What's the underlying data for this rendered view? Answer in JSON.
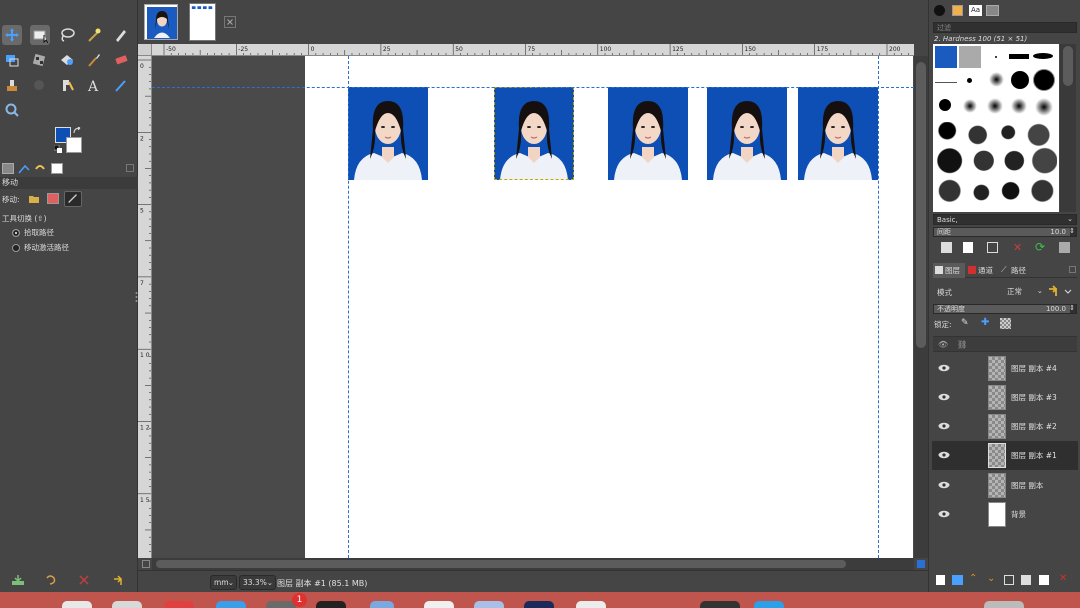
{
  "toolbox": {
    "tools": [
      "move",
      "rect-select",
      "free-select",
      "fuzzy-select",
      "paths",
      "align",
      "unified-transform",
      "warp-transform",
      "paintbrush",
      "eraser",
      "clone",
      "smudge",
      "color-picker",
      "text",
      "dodge-burn",
      "zoom"
    ],
    "fg_color": "#0d4fb4",
    "bg_color": "#ffffff"
  },
  "tool_options": {
    "title": "移动",
    "move_label": "移动:",
    "toggle_label": "工具切换 (⇧)",
    "radio1": "拾取路径",
    "radio2": "移动激活路径"
  },
  "canvas": {
    "ruler_top_labels": [
      "-50",
      "-25",
      "0",
      "25",
      "50",
      "75",
      "100",
      "125",
      "150",
      "175",
      "200"
    ],
    "ruler_left_labels": [
      "0",
      "2",
      "5",
      "7",
      "1 0",
      "1 2",
      "1 5"
    ]
  },
  "statusbar": {
    "unit": "mm",
    "zoom": "33.3%",
    "layer_info": "图层 副本 #1 (85.1 MB)"
  },
  "brushes": {
    "filter_placeholder": "过滤",
    "brush_name": "2. Hardness 100 (51 × 51)",
    "tag_preset": "Basic,",
    "spacing_label": "间距",
    "spacing_value": "10.0"
  },
  "layers": {
    "tabs": [
      "图层",
      "通道",
      "路径"
    ],
    "mode_label": "模式",
    "mode_value": "正常",
    "opacity_label": "不透明度",
    "opacity_value": "100.0",
    "lock_label": "锁定:",
    "items": [
      {
        "name": "图层 副本 #4",
        "selected": false,
        "white": false
      },
      {
        "name": "图层 副本 #3",
        "selected": false,
        "white": false
      },
      {
        "name": "图层 副本 #2",
        "selected": false,
        "white": false
      },
      {
        "name": "图层 副本 #1",
        "selected": true,
        "white": false
      },
      {
        "name": "图层 副本",
        "selected": false,
        "white": false
      },
      {
        "name": "背景",
        "selected": false,
        "white": true
      }
    ]
  },
  "macdock": {
    "badge": "1"
  }
}
